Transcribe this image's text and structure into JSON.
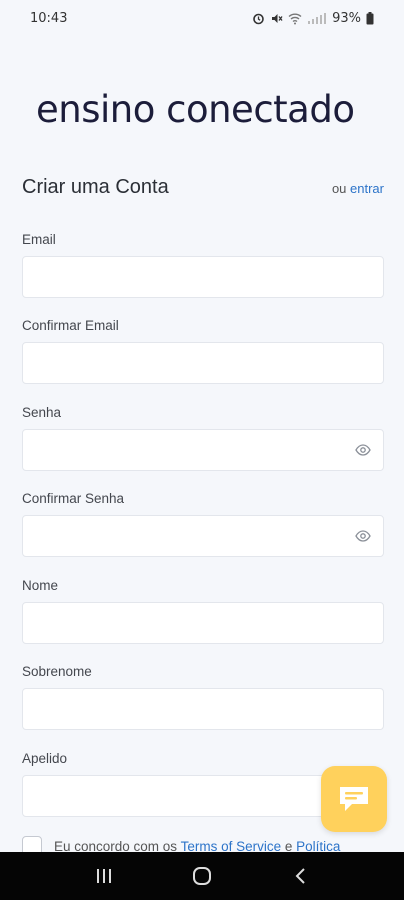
{
  "status_bar": {
    "time": "10:43",
    "battery": "93%"
  },
  "logo": {
    "text": "ensino conectado"
  },
  "header": {
    "title": "Criar uma Conta",
    "or_text": "ou",
    "login_link": "entrar"
  },
  "fields": [
    {
      "label": "Email",
      "value": ""
    },
    {
      "label": "Confirmar Email",
      "value": ""
    },
    {
      "label": "Senha",
      "value": ""
    },
    {
      "label": "Confirmar Senha",
      "value": ""
    },
    {
      "label": "Nome",
      "value": ""
    },
    {
      "label": "Sobrenome",
      "value": ""
    },
    {
      "label": "Apelido",
      "value": ""
    }
  ],
  "terms": {
    "prefix": "Eu concordo com os",
    "terms_link": "Terms of Service",
    "and": "e",
    "policy_link": "Política"
  },
  "colors": {
    "accent": "#2d74c9",
    "chat_button": "#ffd15c",
    "background": "#f5f7fb"
  },
  "icons": {
    "chat": "chat-bubble-icon",
    "password_toggle": "eye-icon"
  }
}
